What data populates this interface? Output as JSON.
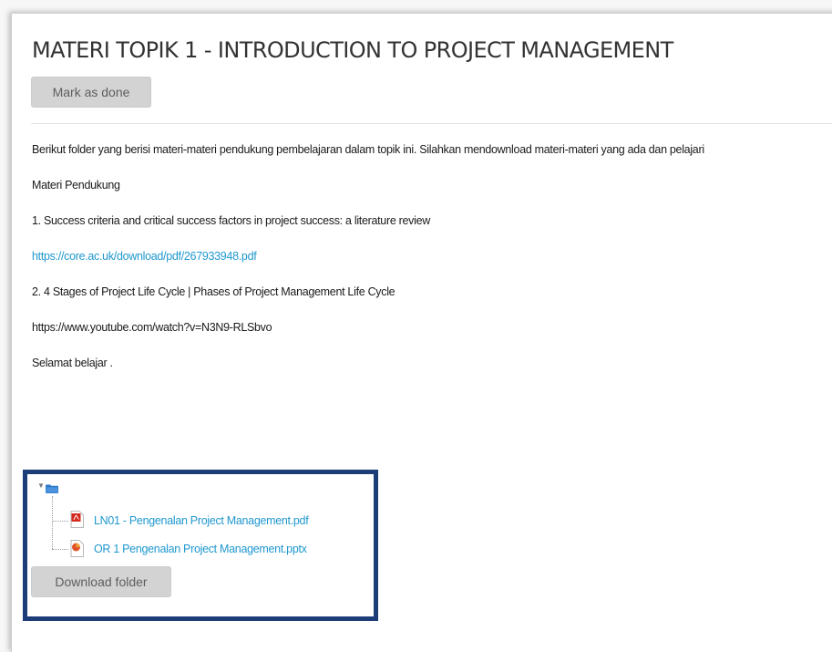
{
  "page": {
    "title": "MATERI TOPIK 1 - INTRODUCTION TO PROJECT MANAGEMENT",
    "mark_done_label": "Mark as done"
  },
  "content": {
    "intro": "Berikut folder yang berisi materi-materi pendukung pembelajaran dalam topik ini. Silahkan mendownload materi-materi yang ada dan pelajari",
    "heading": "Materi Pendukung",
    "item1_title": "1. Success criteria and critical success factors in project success: a literature review",
    "item1_link": "https://core.ac.uk/download/pdf/267933948.pdf",
    "item2_title": "2. 4 Stages of Project Life Cycle | Phases of Project Management Life Cycle",
    "item2_url": "https://www.youtube.com/watch?v=N3N9-RLSbvo",
    "closing": "Selamat belajar ."
  },
  "folder": {
    "toggle_icon": "triangle-down",
    "folder_icon": "folder",
    "files": [
      {
        "name": "LN01 - Pengenalan Project Management.pdf",
        "icon": "pdf-icon"
      },
      {
        "name": "OR 1 Pengenalan Project Management.pptx",
        "icon": "powerpoint-icon"
      }
    ],
    "download_label": "Download folder"
  },
  "colors": {
    "link": "#1f98cf",
    "folder_box_border": "#1d3d79",
    "button_bg": "#d3d3d3",
    "folder_blue": "#2b78c8",
    "pdf_red": "#d42a1e",
    "ppt_orange": "#e0532c"
  }
}
